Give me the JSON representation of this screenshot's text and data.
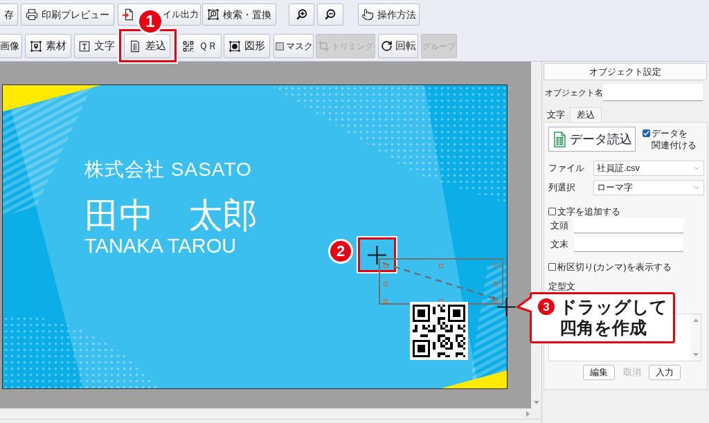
{
  "toolbar_top": [
    {
      "kind": "labeled",
      "label": "存"
    },
    {
      "kind": "labeled",
      "label": "印刷プレビュー"
    },
    {
      "kind": "labeled",
      "label": "イル出力"
    },
    {
      "kind": "labeled",
      "label": "検索・置換"
    },
    {
      "kind": "icon"
    },
    {
      "kind": "icon"
    },
    {
      "kind": "labeled",
      "label": "操作方法"
    }
  ],
  "toolbar_objects": [
    {
      "label": "画像",
      "disabled": false
    },
    {
      "label": "素材",
      "disabled": false
    },
    {
      "label": "文字",
      "disabled": false
    },
    {
      "label": "差込",
      "disabled": false
    },
    {
      "label": "ＱＲ",
      "disabled": false
    },
    {
      "label": "図形",
      "disabled": false
    },
    {
      "label": "マスク",
      "disabled": false
    },
    {
      "label": "トリミング",
      "disabled": true
    },
    {
      "label": "回転",
      "disabled": false
    },
    {
      "label": "グループ",
      "disabled": true
    }
  ],
  "card": {
    "company": "株式会社 SASATO",
    "name": "田中　太郎",
    "name_roman": "TANAKA TAROU"
  },
  "panel": {
    "title": "オブジェクト設定",
    "object_name": {
      "label": "オブジェクト名"
    },
    "tabs": [
      {
        "label": "文字",
        "selected": false
      },
      {
        "label": "差込",
        "selected": true
      }
    ],
    "load_button": "データ読込",
    "link_data": {
      "label_lines": [
        "データを",
        "関連付ける"
      ],
      "checked": true
    },
    "file": {
      "label": "ファイル",
      "value": "社員証.csv"
    },
    "column": {
      "label": "列選択",
      "value": "ローマ字"
    },
    "add_text": {
      "label": "文字を追加する",
      "checked": false
    },
    "prefix": {
      "label": "文頭"
    },
    "suffix": {
      "label": "文末"
    },
    "thousands_separator": {
      "label": "桁区切り(カンマ)を表示する",
      "checked": false
    },
    "template_label": "定型文",
    "buttons": [
      {
        "label": "編集",
        "disabled": false
      },
      {
        "label": "取消",
        "disabled": true
      },
      {
        "label": "入力",
        "disabled": false
      }
    ]
  },
  "annotations": [
    {
      "number": "1"
    },
    {
      "number": "2"
    },
    {
      "number": "3",
      "lines": [
        "ドラッグして",
        "四角を作成"
      ]
    }
  ]
}
